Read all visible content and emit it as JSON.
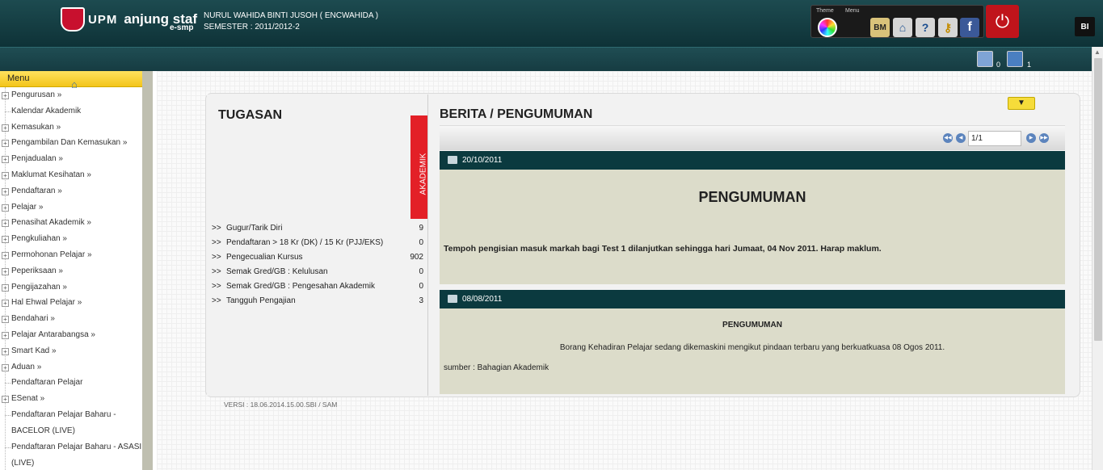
{
  "header": {
    "logo_upm": "UPM",
    "logo_brand": "anjung staf",
    "logo_sub": "e-smp",
    "user_name": "NURUL WAHIDA BINTI JUSOH ( ENCWAHIDA )",
    "semester": "SEMESTER : 2011/2012-2",
    "toolbar": {
      "theme_label": "Theme",
      "menu_label": "Menu",
      "bm_label": "BM",
      "help_label": "?",
      "facebook_label": "f"
    },
    "power_icon": "⏻",
    "bi_label": "BI"
  },
  "subbar": {
    "mobile_count": "0",
    "desktop_count": "1"
  },
  "menu": {
    "title": "Menu",
    "items": [
      {
        "label": "Pengurusan »",
        "expandable": true
      },
      {
        "label": "Kalendar Akademik",
        "expandable": false
      },
      {
        "label": "Kemasukan »",
        "expandable": true
      },
      {
        "label": "Pengambilan Dan Kemasukan »",
        "expandable": true
      },
      {
        "label": "Penjadualan »",
        "expandable": true
      },
      {
        "label": "Maklumat Kesihatan »",
        "expandable": true
      },
      {
        "label": "Pendaftaran »",
        "expandable": true
      },
      {
        "label": "Pelajar »",
        "expandable": true
      },
      {
        "label": "Penasihat Akademik »",
        "expandable": true
      },
      {
        "label": "Pengkuliahan »",
        "expandable": true
      },
      {
        "label": "Permohonan Pelajar »",
        "expandable": true
      },
      {
        "label": "Peperiksaan »",
        "expandable": true
      },
      {
        "label": "Pengijazahan »",
        "expandable": true
      },
      {
        "label": "Hal Ehwal Pelajar »",
        "expandable": true
      },
      {
        "label": "Bendahari »",
        "expandable": true
      },
      {
        "label": "Pelajar Antarabangsa »",
        "expandable": true
      },
      {
        "label": "Smart Kad »",
        "expandable": true
      },
      {
        "label": "Aduan »",
        "expandable": true
      },
      {
        "label": "Pendaftaran Pelajar",
        "expandable": false
      },
      {
        "label": "ESenat »",
        "expandable": true
      },
      {
        "label": "Pendaftaran Pelajar Baharu - BACELOR (LIVE)",
        "expandable": false
      },
      {
        "label": "Pendaftaran Pelajar Baharu - ASASI (LIVE)",
        "expandable": false
      }
    ]
  },
  "tugasan": {
    "title": "TUGASAN",
    "tab_label": "AKADEMIK",
    "arrow": ">>",
    "tasks": [
      {
        "label": "Gugur/Tarik Diri",
        "value": "9"
      },
      {
        "label": "Pendaftaran > 18 Kr (DK) / 15 Kr (PJJ/EKS)",
        "value": "0"
      },
      {
        "label": "Pengecualian Kursus",
        "value": "902"
      },
      {
        "label": "Semak Gred/GB : Kelulusan",
        "value": "0"
      },
      {
        "label": "Semak Gred/GB : Pengesahan Akademik",
        "value": "0"
      },
      {
        "label": "Tangguh Pengajian",
        "value": "3"
      }
    ]
  },
  "berita": {
    "title": "BERITA / PENGUMUMAN",
    "collapse_icon": "▼",
    "pager_value": "1/1",
    "news": [
      {
        "date": "20/10/2011",
        "heading": "PENGUMUMAN",
        "text": "Tempoh pengisian masuk markah bagi Test 1 dilanjutkan sehingga hari Jumaat, 04 Nov 2011. Harap maklum."
      },
      {
        "date": "08/08/2011",
        "heading": "PENGUMUMAN",
        "text": "Borang Kehadiran Pelajar sedang dikemaskini mengikut pindaan terbaru yang berkuatkuasa 08 Ogos 2011.",
        "source": "sumber : Bahagian Akademik"
      }
    ]
  },
  "footer": {
    "version": "VERSI : 18.06.2014.15.00.SBI / SAM"
  }
}
